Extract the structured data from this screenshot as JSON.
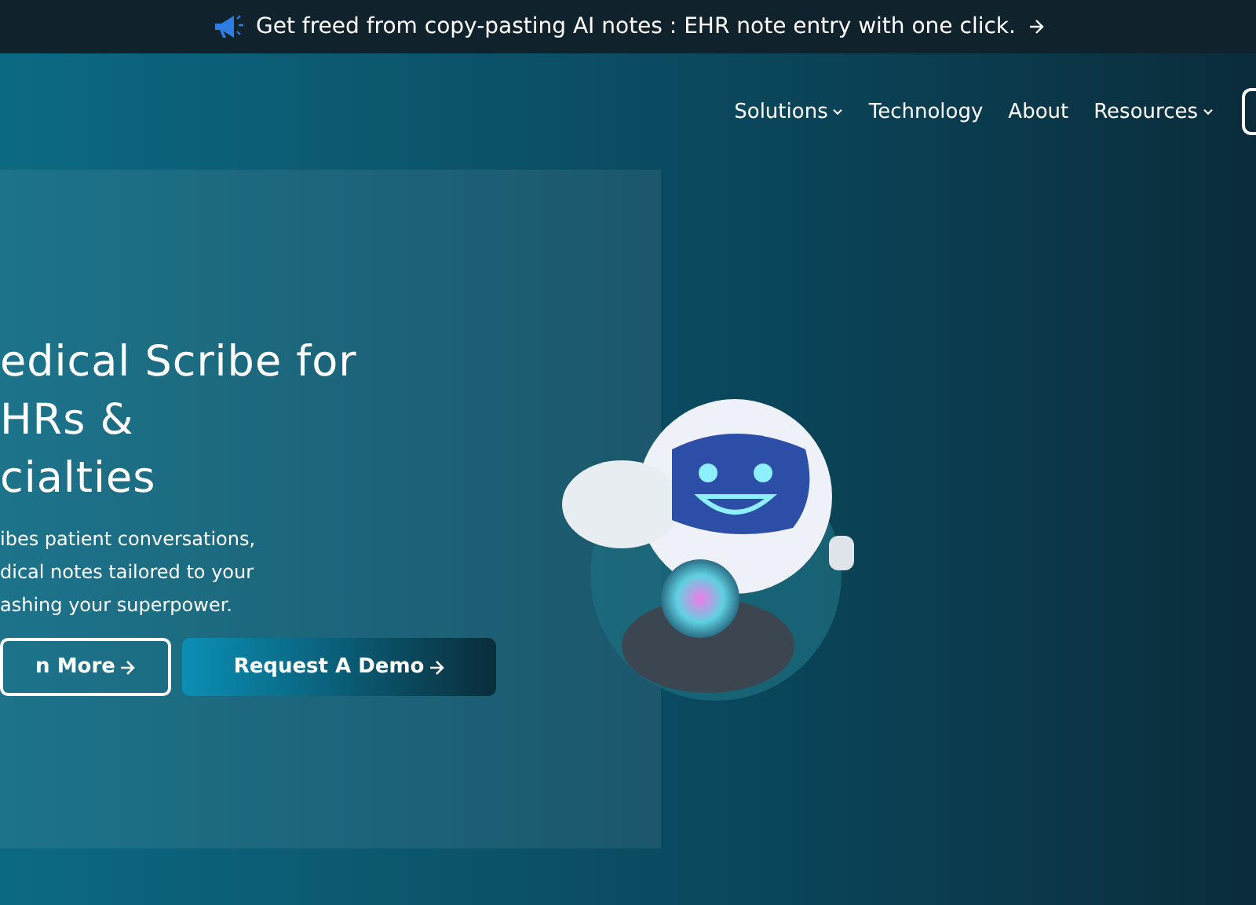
{
  "announcement": {
    "text": "Get freed from copy-pasting AI notes : EHR note entry with one click."
  },
  "nav": {
    "items": [
      {
        "label": "Solutions",
        "dropdown": true
      },
      {
        "label": "Technology",
        "dropdown": false
      },
      {
        "label": "About",
        "dropdown": false
      },
      {
        "label": "Resources",
        "dropdown": true
      }
    ]
  },
  "hero": {
    "headline_lines": [
      "edical Scribe for",
      "HRs &",
      "cialties"
    ],
    "body_lines": [
      "ibes patient conversations,",
      "dical notes tailored to your",
      "ashing your superpower."
    ],
    "buttons": [
      {
        "label": "n More",
        "kind": "outline"
      },
      {
        "label": "Request A Demo",
        "kind": "filled"
      }
    ]
  }
}
